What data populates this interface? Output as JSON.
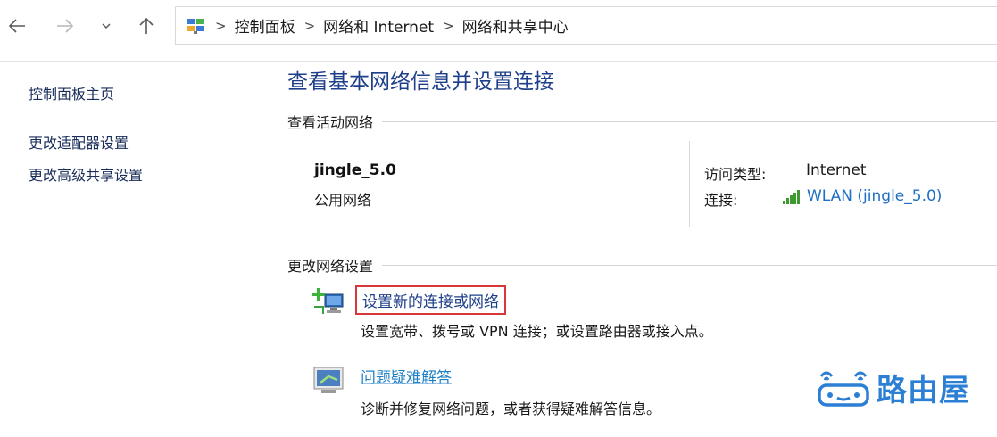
{
  "nav": {
    "back_icon": "arrow-left-icon",
    "forward_icon": "arrow-right-icon",
    "recent_icon": "chevron-down-icon",
    "up_icon": "arrow-up-icon"
  },
  "address": {
    "icon": "control-panel-icon",
    "breadcrumbs": [
      "控制面板",
      "网络和 Internet",
      "网络和共享中心"
    ]
  },
  "sidebar": {
    "items": [
      {
        "label": "控制面板主页"
      },
      {
        "label": "更改适配器设置"
      },
      {
        "label": "更改高级共享设置"
      }
    ]
  },
  "main": {
    "title": "查看基本网络信息并设置连接",
    "active_section": "查看活动网络",
    "network": {
      "name": "jingle_5.0",
      "type": "公用网络",
      "access_label": "访问类型:",
      "access_value": "Internet",
      "connection_label": "连接:",
      "connection_value": "WLAN (jingle_5.0)",
      "signal_icon": "wifi-signal-icon"
    },
    "change_section": "更改网络设置",
    "tasks": [
      {
        "title": "设置新的连接或网络",
        "description": "设置宽带、拨号或 VPN 连接；或设置路由器或接入点。",
        "icon": "new-connection-icon"
      },
      {
        "title": "问题疑难解答",
        "description": "诊断并修复网络问题，或者获得疑难解答信息。",
        "icon": "troubleshoot-icon"
      }
    ]
  },
  "watermark": {
    "text": "路由屋",
    "icon": "router-logo-icon"
  },
  "colors": {
    "link": "#1f6fc4",
    "title": "#1e3f8a",
    "highlight_border": "#d9383a",
    "watermark": "#2b7fd4"
  }
}
